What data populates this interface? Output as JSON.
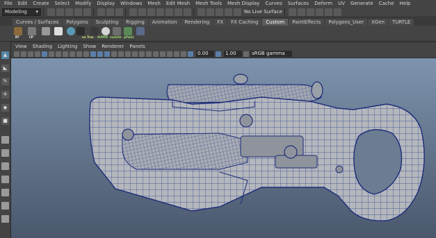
{
  "menubar": {
    "items": [
      "File",
      "Edit",
      "Create",
      "Select",
      "Modify",
      "Display",
      "Windows",
      "Mesh",
      "Edit Mesh",
      "Mesh Tools",
      "Mesh Display",
      "Curves",
      "Surfaces",
      "Deform",
      "UV",
      "Generate",
      "Cache",
      "Help"
    ]
  },
  "statusline": {
    "mode": "Modeling",
    "live_surface": "No Live Surface"
  },
  "shelf_tabs": {
    "items": [
      "Curves / Surfaces",
      "Polygons",
      "Sculpting",
      "Rigging",
      "Animation",
      "Rendering",
      "FX",
      "FX Caching",
      "Custom",
      "PaintEffects",
      "Polygons_User",
      "XGen",
      "TURTLE"
    ],
    "active": "Custom"
  },
  "shelf": {
    "labels": [
      "RT",
      "CP",
      "ne Tran",
      "SUPPR",
      "nackGe",
      "pPaint"
    ]
  },
  "viewport_menu": {
    "items": [
      "View",
      "Shading",
      "Lighting",
      "Show",
      "Renderer",
      "Panels"
    ]
  },
  "viewport_toolbar": {
    "near_value": "0.00",
    "far_value": "1.00",
    "color_space": "sRGB gamma"
  },
  "colors": {
    "accent": "#5285a6",
    "wire": "#2a3d8f"
  }
}
